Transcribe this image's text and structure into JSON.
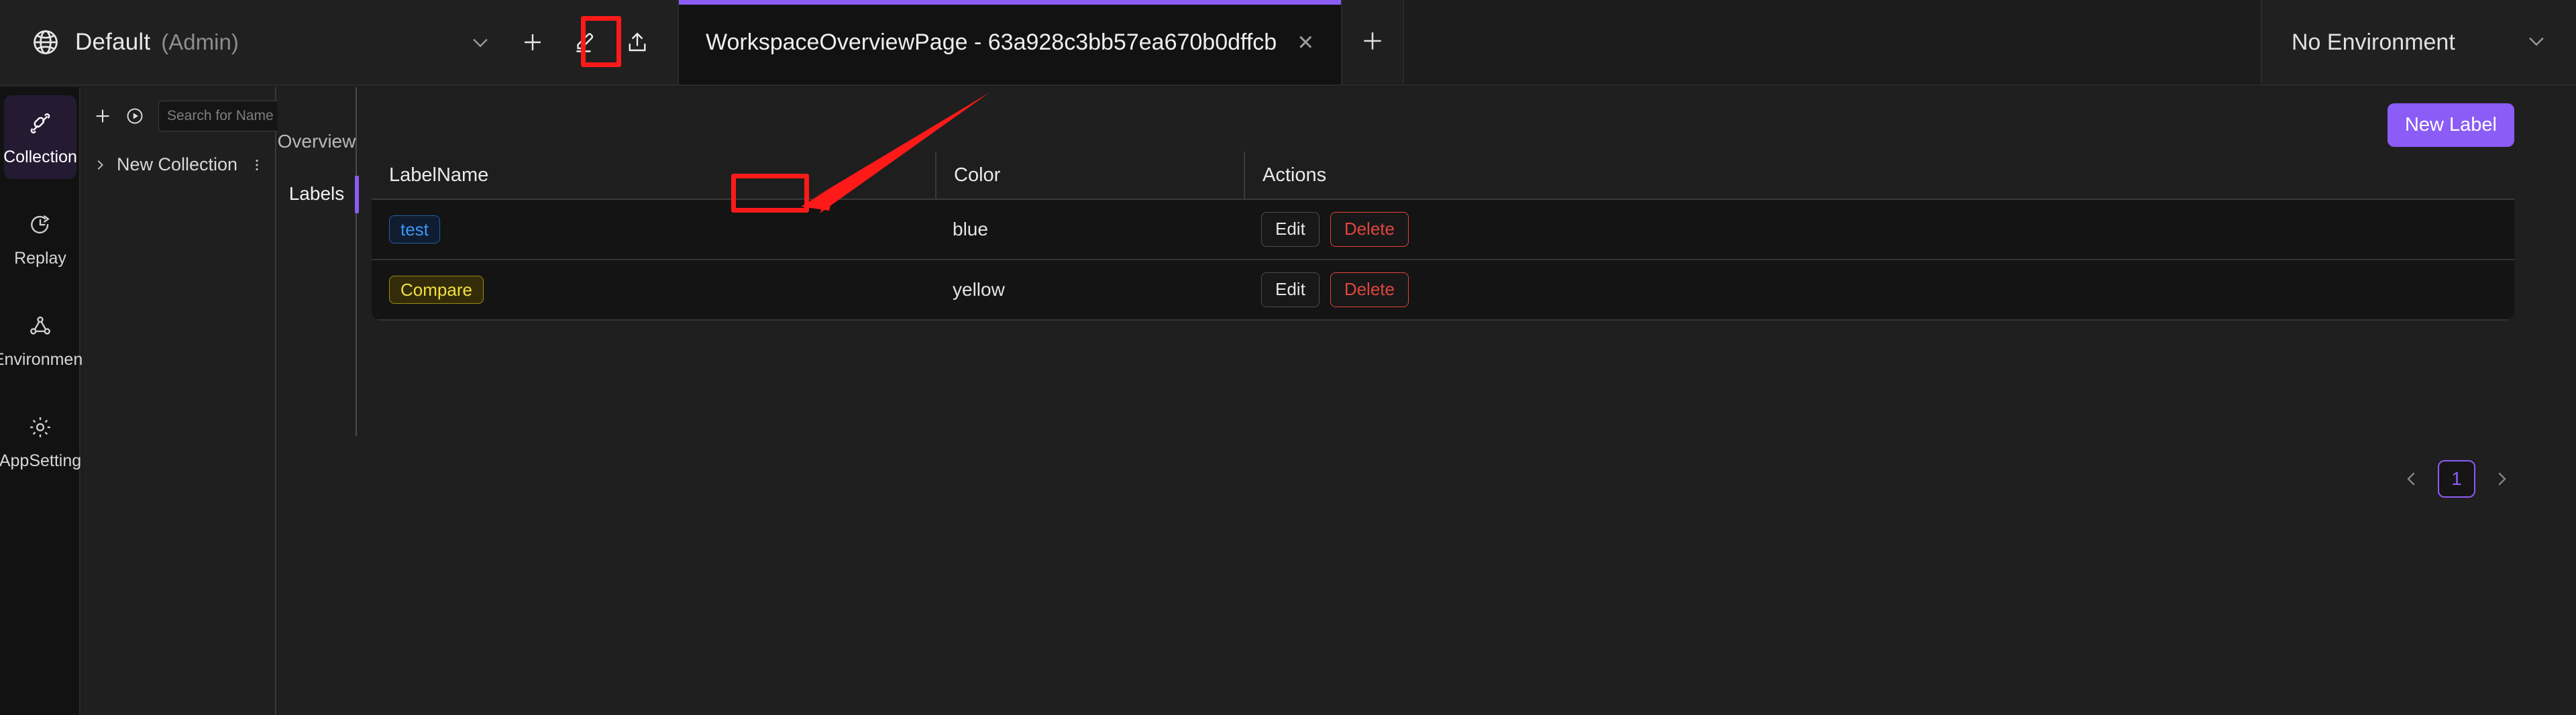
{
  "topbar": {
    "globe_icon": "globe-icon",
    "workspace_name": "Default",
    "workspace_role": "(Admin)",
    "chevron_icon": "chevron-down-icon",
    "add_icon": "plus-icon",
    "edit_icon": "pencil-edit-icon",
    "import_icon": "upload-icon",
    "tab": {
      "title": "WorkspaceOverviewPage - 63a928c3bb57ea670b0dffcb",
      "close_icon": "close-icon"
    },
    "new_tab_icon": "plus-icon",
    "environment": {
      "label": "No Environment",
      "chevron_icon": "chevron-down-icon"
    }
  },
  "rail": {
    "items": [
      {
        "label": "Collection",
        "icon": "plug-connection-icon",
        "active": true
      },
      {
        "label": "Replay",
        "icon": "clock-replay-icon",
        "active": false
      },
      {
        "label": "Environment",
        "icon": "node-graph-icon",
        "active": false
      },
      {
        "label": "AppSetting",
        "icon": "gear-icon",
        "active": false
      }
    ]
  },
  "collection_panel": {
    "add_icon": "plus-icon",
    "run_icon": "play-circle-icon",
    "search": {
      "placeholder": "Search for Name or Id",
      "value": "",
      "icon": "search-icon"
    },
    "tree": [
      {
        "label": "New Collection",
        "caret_icon": "chevron-right-icon",
        "menu_icon": "more-vertical-icon"
      }
    ]
  },
  "content": {
    "side_tabs": [
      {
        "label": "Overview",
        "active": false
      },
      {
        "label": "Labels",
        "active": true
      }
    ],
    "new_label_button": "New Label",
    "table": {
      "columns": [
        "LabelName",
        "Color",
        "Actions"
      ],
      "rows": [
        {
          "label_name": "test",
          "chip_style": "blue",
          "color": "blue",
          "edit_label": "Edit",
          "delete_label": "Delete"
        },
        {
          "label_name": "Compare",
          "chip_style": "yellow",
          "color": "yellow",
          "edit_label": "Edit",
          "delete_label": "Delete"
        }
      ]
    },
    "pagination": {
      "prev_icon": "chevron-left-icon",
      "current_page": "1",
      "next_icon": "chevron-right-icon"
    }
  },
  "annotations": {
    "edit_icon_highlight": "red-box-around-edit-icon",
    "labels_tab_highlight": "red-box-around-labels-tab",
    "arrow": "red-arrow-pointing-to-labels-tab",
    "color": "#ff1a1a"
  },
  "colors": {
    "accent_purple": "#8b5cf6",
    "danger_red": "#e0453c",
    "chip_blue": "#3b97f5",
    "chip_yellow": "#f0e040"
  }
}
